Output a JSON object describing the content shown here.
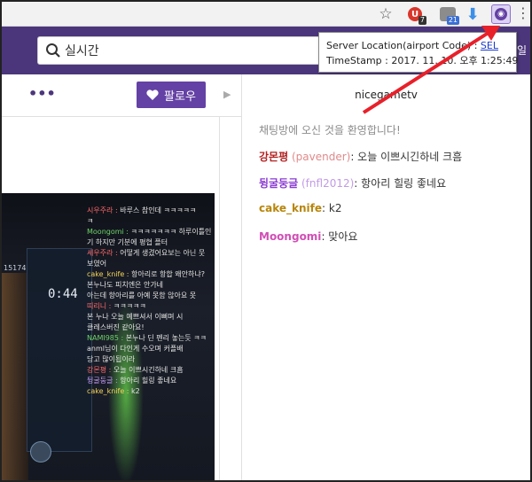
{
  "search": {
    "value": "실시간"
  },
  "toolbar": {
    "ext_red_badge": "7",
    "ext_gray_badge": "21",
    "ext_red_letter": "U"
  },
  "tooltip": {
    "line1_prefix": "Server Location(airport Code) : ",
    "line1_link": "SEL",
    "line2": "TimeStamp : 2017. 11. 10. 오후 1:25:49"
  },
  "header": {
    "right_text": "파일"
  },
  "follow": {
    "label": "팔로우"
  },
  "chat": {
    "channel": "nicegametv",
    "welcome": "채팅방에 오신 것을 환영합니다!",
    "messages": [
      {
        "name": "강몬평",
        "id": "(pavender)",
        "text": "오늘 이쁘시긴하네 크흠"
      },
      {
        "name": "뒹굴둥글",
        "id": "(fnfl2012)",
        "text": "항아리 힐링 좋네요"
      },
      {
        "name": "cake_knife",
        "id": "",
        "text": "k2"
      },
      {
        "name": "Moongomi",
        "id": "",
        "text": "맞아요"
      }
    ]
  },
  "video": {
    "timer": "0:44",
    "counter": "15174",
    "overlay": [
      {
        "name": "시우주라 :",
        "text": "바루스 참인데 ㅋㅋㅋㅋㅋ"
      },
      {
        "name": "",
        "text": "ㅋ"
      },
      {
        "name": "Moongomi :",
        "text": "ㅋㅋㅋㅋㅋㅋㅋ 하루이틀인"
      },
      {
        "name": "",
        "text": "기 하지만 기분에 평협 플터"
      },
      {
        "name": "세우주라 :",
        "text": "어떻게 생겼어요보는 아닌 뭇"
      },
      {
        "name": "",
        "text": "보였어"
      },
      {
        "name": "cake_knife :",
        "text": "항아리로 항합 왜안하냐?"
      },
      {
        "name": "",
        "text": "본누나도 피치엔은 안가네"
      },
      {
        "name": "",
        "text": "아는데 항아리를 아예 못함 않아요 못"
      },
      {
        "name": "띠리니 :",
        "text": "ㅋㅋㅋㅋㅋ"
      },
      {
        "name": "",
        "text": "본 누나 오늘 예쁘셔서 이뻐며 시"
      },
      {
        "name": "",
        "text": "클레스버진 같아요!"
      },
      {
        "name": "NAMI985 :",
        "text": "본누나 딘 펜리 놓는듯 ㅋㅋ"
      },
      {
        "name": "",
        "text": "anml님이 다인게 수오며 커플배"
      },
      {
        "name": "",
        "text": "당고 많이됩이라"
      },
      {
        "name": "강몬평 :",
        "text": "오늘 이쁘시긴하네 크흠"
      },
      {
        "name": "뒹굴둥글 :",
        "text": "항아리 힐링 좋네요"
      },
      {
        "name": "cake_knife :",
        "text": "k2"
      }
    ]
  }
}
